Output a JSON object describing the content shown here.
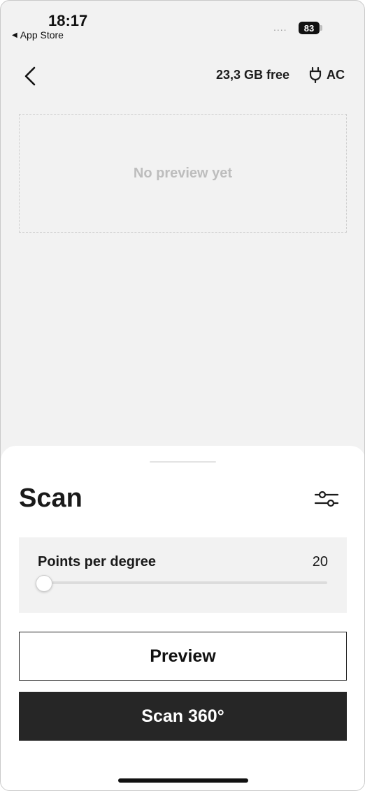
{
  "status_bar": {
    "time": "18:17",
    "back_app_label": "App Store",
    "signal": "....",
    "battery_percent": "83"
  },
  "header": {
    "storage_free": "23,3 GB free",
    "power_label": "AC"
  },
  "preview": {
    "placeholder": "No preview yet"
  },
  "sheet": {
    "title": "Scan",
    "slider": {
      "label": "Points per degree",
      "value": "20",
      "fraction": 0.0
    },
    "preview_button_label": "Preview",
    "scan_button_label": "Scan 360°"
  },
  "colors": {
    "background": "#f2f2f2",
    "sheet": "#ffffff",
    "primary_button": "#262626",
    "text": "#1a1a1a"
  }
}
